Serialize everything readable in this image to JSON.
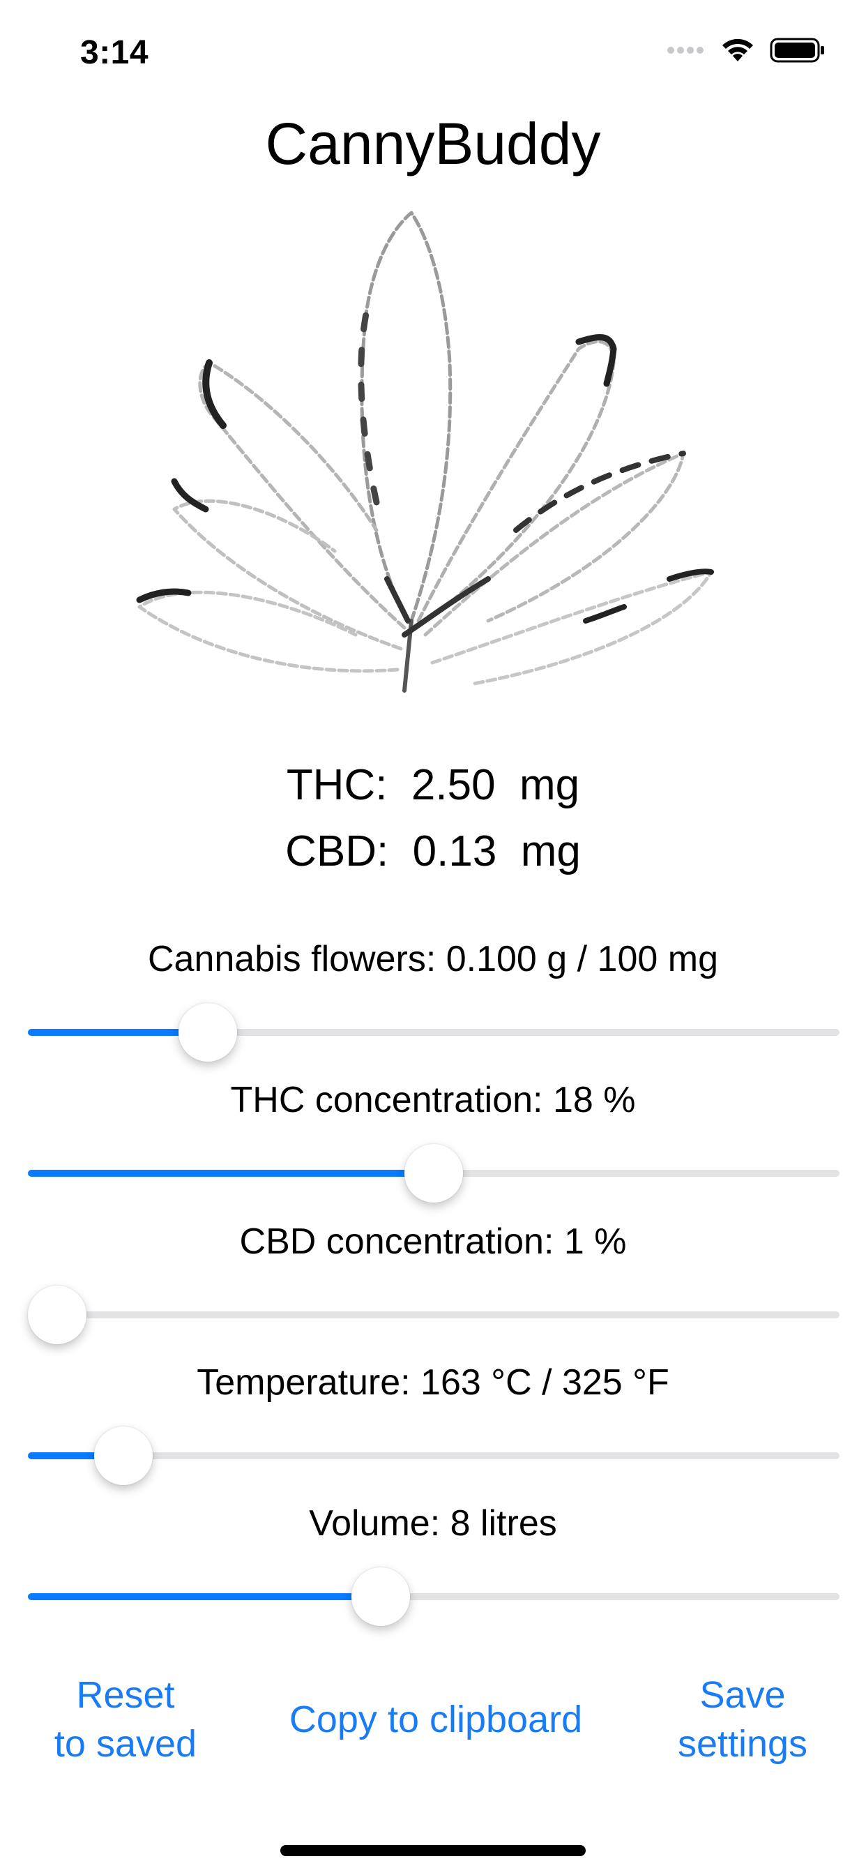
{
  "status_bar": {
    "time": "3:14"
  },
  "app": {
    "title": "CannyBuddy"
  },
  "dose": {
    "thc": "THC:  2.50  mg",
    "cbd": "CBD:  0.13  mg"
  },
  "sliders": [
    {
      "label": "Cannabis flowers: 0.100 g / 100 mg",
      "value_fraction": 0.2
    },
    {
      "label": "THC concentration: 18 %",
      "value_fraction": 0.5
    },
    {
      "label": "CBD concentration: 1 %",
      "value_fraction": 0.0
    },
    {
      "label": "Temperature: 163 °C / 325 °F",
      "value_fraction": 0.088
    },
    {
      "label": "Volume: 8 litres",
      "value_fraction": 0.43
    }
  ],
  "buttons": {
    "reset": "Reset\nto saved",
    "copy": "Copy to clipboard",
    "save": "Save\nsettings"
  },
  "colors": {
    "accent": "#0a7aff",
    "link": "#1a7cf5",
    "track": "#e3e3e6"
  },
  "icons": [
    "signal-dots-icon",
    "wifi-icon",
    "battery-icon",
    "cannabis-leaf-illustration"
  ]
}
